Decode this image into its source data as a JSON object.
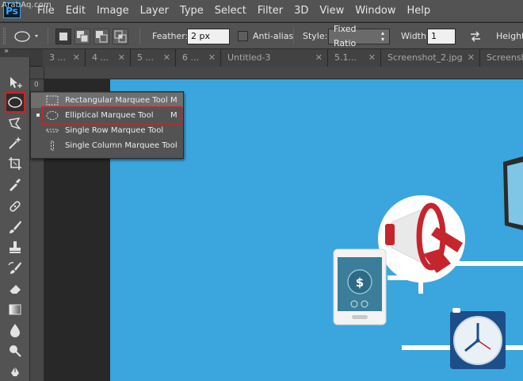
{
  "watermark": "ArabAq.com",
  "logo": "Ps",
  "menu": [
    "File",
    "Edit",
    "Image",
    "Layer",
    "Type",
    "Select",
    "Filter",
    "3D",
    "View",
    "Window",
    "Help"
  ],
  "options": {
    "feather_label": "Feather:",
    "feather_value": "2 px",
    "antialias_label": "Anti-alias",
    "style_label": "Style:",
    "style_value": "Fixed Ratio",
    "width_label": "Width:",
    "width_value": "1",
    "height_label": "Height:"
  },
  "tabs": [
    {
      "label": "3 ..."
    },
    {
      "label": "4 ..."
    },
    {
      "label": "5 ..."
    },
    {
      "label": "6 ..."
    },
    {
      "label": "Untitled-3"
    },
    {
      "label": "5.1..."
    },
    {
      "label": "Screenshot_2.jpg"
    },
    {
      "label": "Screensh"
    }
  ],
  "ruler": {
    "zero": "0"
  },
  "flyout": {
    "items": [
      {
        "label": "Rectangular Marquee Tool",
        "shortcut": "M",
        "icon": "rectangle-marquee-icon"
      },
      {
        "label": "Elliptical Marquee Tool",
        "shortcut": "M",
        "icon": "ellipse-marquee-icon",
        "active": true
      },
      {
        "label": "Single Row Marquee Tool",
        "shortcut": "",
        "icon": "single-row-marquee-icon"
      },
      {
        "label": "Single Column Marquee Tool",
        "shortcut": "",
        "icon": "single-column-marquee-icon"
      }
    ]
  },
  "tools": [
    "move-tool-icon",
    "elliptical-marquee-icon",
    "lasso-icon",
    "magic-wand-icon",
    "crop-icon",
    "eyedropper-icon",
    "healing-brush-icon",
    "brush-icon",
    "clone-stamp-icon",
    "history-brush-icon",
    "eraser-icon",
    "gradient-icon",
    "blur-icon",
    "dodge-icon",
    "pen-icon"
  ],
  "colors": {
    "accent_highlight": "#d11f26",
    "canvas_bg": "#3aa6dd",
    "panel_bg": "#535353"
  }
}
